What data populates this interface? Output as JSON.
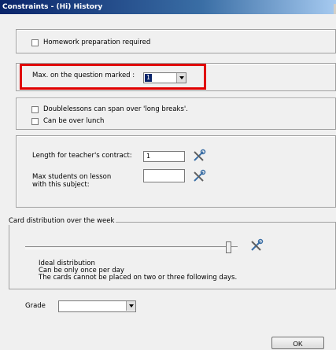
{
  "window": {
    "title": "Constraints - (Hi) History"
  },
  "homework": {
    "label": "Homework preparation required",
    "checked": false
  },
  "max_question": {
    "label": "Max. on the question marked :",
    "value": "1"
  },
  "doublelessons": {
    "long_breaks_label": "Doublelessons can span over 'long breaks'.",
    "lunch_label": "Can be over lunch"
  },
  "contract": {
    "length_label": "Length for teacher's contract:",
    "length_value": "1",
    "max_students_label": "Max students on lesson with this subject:",
    "max_students_value": ""
  },
  "distribution": {
    "legend": "Card distribution over the week",
    "lines": [
      "Ideal distribution",
      "Can be only once per day",
      "The cards cannot be placed on two or three following days."
    ]
  },
  "grade": {
    "label": "Grade",
    "value": ""
  },
  "buttons": {
    "ok": "OK"
  },
  "icons": {
    "tool": "wrench-screwdriver-icon"
  }
}
